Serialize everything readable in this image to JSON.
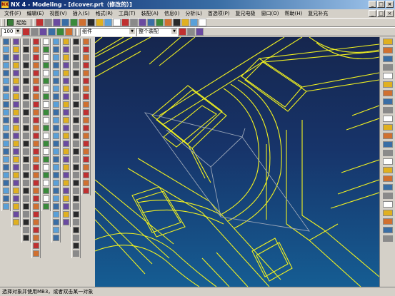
{
  "window": {
    "logo": "NX",
    "title": "NX 4 - Modeling - [dcover.prt（修改的）]",
    "controls": [
      "_",
      "□",
      "×"
    ]
  },
  "menu": {
    "items": [
      "文件(F)",
      "编辑(E)",
      "视图(V)",
      "插入(S)",
      "格式(R)",
      "工具(T)",
      "装配(A)",
      "信息(I)",
      "分析(L)",
      "首选项(P)",
      "复兄电极",
      "窗口(O)",
      "帮助(H)",
      "复兄补充"
    ],
    "doc_controls": [
      "_",
      "□",
      "×"
    ]
  },
  "toolbar1": {
    "start_label": "起始"
  },
  "toolbar2": {
    "zoom_value": "100",
    "filter_value": "组件",
    "assembly_value": "整个装配"
  },
  "status": {
    "prompt": "选择对象并使用MB3，或者双击某一对象"
  },
  "colors": {
    "viewport_top": "#16264e",
    "viewport_bottom": "#155d93",
    "wire_yellow": "#f2f220",
    "wire_gray": "#9aa6b8",
    "title_gradient_start": "#0a246a"
  },
  "icons": {
    "toolbar1": [
      "new-file-icon",
      "open-icon",
      "save-icon",
      "print-icon",
      "cut-icon",
      "copy-icon",
      "paste-icon",
      "delete-icon",
      "undo-icon",
      "redo-icon",
      "select-icon",
      "zoom-icon",
      "rotate-icon",
      "pan-icon",
      "fit-icon",
      "shaded-icon",
      "wireframe-icon",
      "view-front-icon",
      "view-top-icon",
      "view-iso-icon"
    ],
    "toolbar2": [
      "selection-filter-icon",
      "point-snap-icon",
      "endpoint-icon",
      "midpoint-icon",
      "center-icon",
      "quadrant-icon",
      "intersection-icon",
      "existing-point-icon",
      "brush-icon"
    ]
  }
}
